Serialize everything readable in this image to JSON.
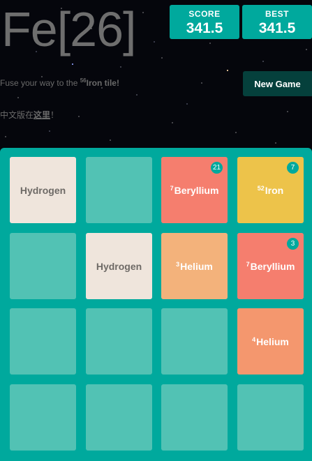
{
  "header": {
    "title": "Fe[26]"
  },
  "scores": {
    "score_label": "SCORE",
    "score_value": "341.5",
    "best_label": "BEST",
    "best_value": "341.5"
  },
  "intro": {
    "prefix": "Fuse your way to the ",
    "mass": "56",
    "target": "Iron tile!"
  },
  "new_game_label": "New Game",
  "lang": {
    "prefix": "中文版在",
    "link": "这里",
    "suffix": "！"
  },
  "board": {
    "tiles": [
      {
        "row": 0,
        "col": 0,
        "mass": "",
        "label": "Hydrogen",
        "kind": "hydrogen",
        "count": ""
      },
      {
        "row": 0,
        "col": 2,
        "mass": "7",
        "label": "Beryllium",
        "kind": "beryllium",
        "count": "21"
      },
      {
        "row": 0,
        "col": 3,
        "mass": "52",
        "label": "Iron",
        "kind": "iron",
        "count": "7"
      },
      {
        "row": 1,
        "col": 1,
        "mass": "",
        "label": "Hydrogen",
        "kind": "hydrogen",
        "count": ""
      },
      {
        "row": 1,
        "col": 2,
        "mass": "3",
        "label": "Helium",
        "kind": "helium3",
        "count": ""
      },
      {
        "row": 1,
        "col": 3,
        "mass": "7",
        "label": "Beryllium",
        "kind": "beryllium",
        "count": "3"
      },
      {
        "row": 2,
        "col": 3,
        "mass": "4",
        "label": "Helium",
        "kind": "helium4",
        "count": ""
      }
    ]
  },
  "colors": {
    "board": "#00a99d",
    "empty_cell": "#52c2b4",
    "hydrogen": "#efe5dc",
    "helium3": "#f3b27b",
    "helium4": "#f4976e",
    "beryllium": "#f57e6e",
    "iron": "#edc34a",
    "new_game_button": "#05403c"
  }
}
